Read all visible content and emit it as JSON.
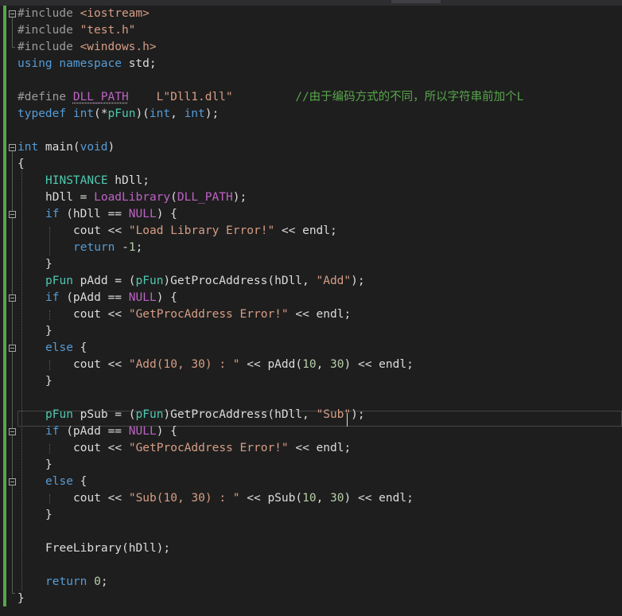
{
  "lines": {
    "l0": [
      "#include ",
      "<iostream>"
    ],
    "l1": [
      "#include ",
      "\"test.h\""
    ],
    "l2": [
      "#include ",
      "<windows.h>"
    ],
    "l3": [
      "using",
      " ",
      "namespace",
      " std;"
    ],
    "l5": [
      "#define ",
      "DLL_PATH",
      "    ",
      "L\"Dll1.dll\"",
      "         ",
      "//由于编码方式的不同，所以字符串前加个L"
    ],
    "l6": [
      "typedef",
      " ",
      "int",
      "(*",
      "pFun",
      ")(",
      "int",
      ", ",
      "int",
      ");"
    ],
    "l8": [
      "int",
      " main(",
      "void",
      ")"
    ],
    "l9": [
      "{"
    ],
    "l10": [
      "HINSTANCE",
      " hDll;"
    ],
    "l11": [
      "hDll = ",
      "LoadLibrary",
      "(",
      "DLL_PATH",
      ");"
    ],
    "l12": [
      "if",
      " (hDll == ",
      "NULL",
      ") {"
    ],
    "l13": [
      "cout << ",
      "\"Load Library Error!\"",
      " << endl;"
    ],
    "l14": [
      "return",
      " -",
      "1",
      ";"
    ],
    "l15": [
      "}"
    ],
    "l16": [
      "pFun",
      " pAdd = (",
      "pFun",
      ")GetProcAddress(hDll, ",
      "\"Add\"",
      ");"
    ],
    "l17": [
      "if",
      " (pAdd == ",
      "NULL",
      ") {"
    ],
    "l18": [
      "cout << ",
      "\"GetProcAddress Error!\"",
      " << endl;"
    ],
    "l19": [
      "}"
    ],
    "l20": [
      "else",
      " {"
    ],
    "l21": [
      "cout << ",
      "\"Add(10, 30) : \"",
      " << pAdd(",
      "10",
      ", ",
      "30",
      ") << endl;"
    ],
    "l22": [
      "}"
    ],
    "l24": [
      "pFun",
      " pSub = (",
      "pFun",
      ")GetProcAddress(hDll, ",
      "\"Sub\"",
      ");"
    ],
    "l25": [
      "if",
      " (pAdd == ",
      "NULL",
      ") {"
    ],
    "l26": [
      "cout << ",
      "\"GetProcAddress Error!\"",
      " << endl;"
    ],
    "l27": [
      "}"
    ],
    "l28": [
      "else",
      " {"
    ],
    "l29": [
      "cout << ",
      "\"Sub(10, 30) : \"",
      " << pSub(",
      "10",
      ", ",
      "30",
      ") << endl;"
    ],
    "l30": [
      "}"
    ],
    "l32": [
      "FreeLibrary",
      "(hDll);"
    ],
    "l34": [
      "return",
      " ",
      "0",
      ";"
    ],
    "l35": [
      "}"
    ]
  }
}
